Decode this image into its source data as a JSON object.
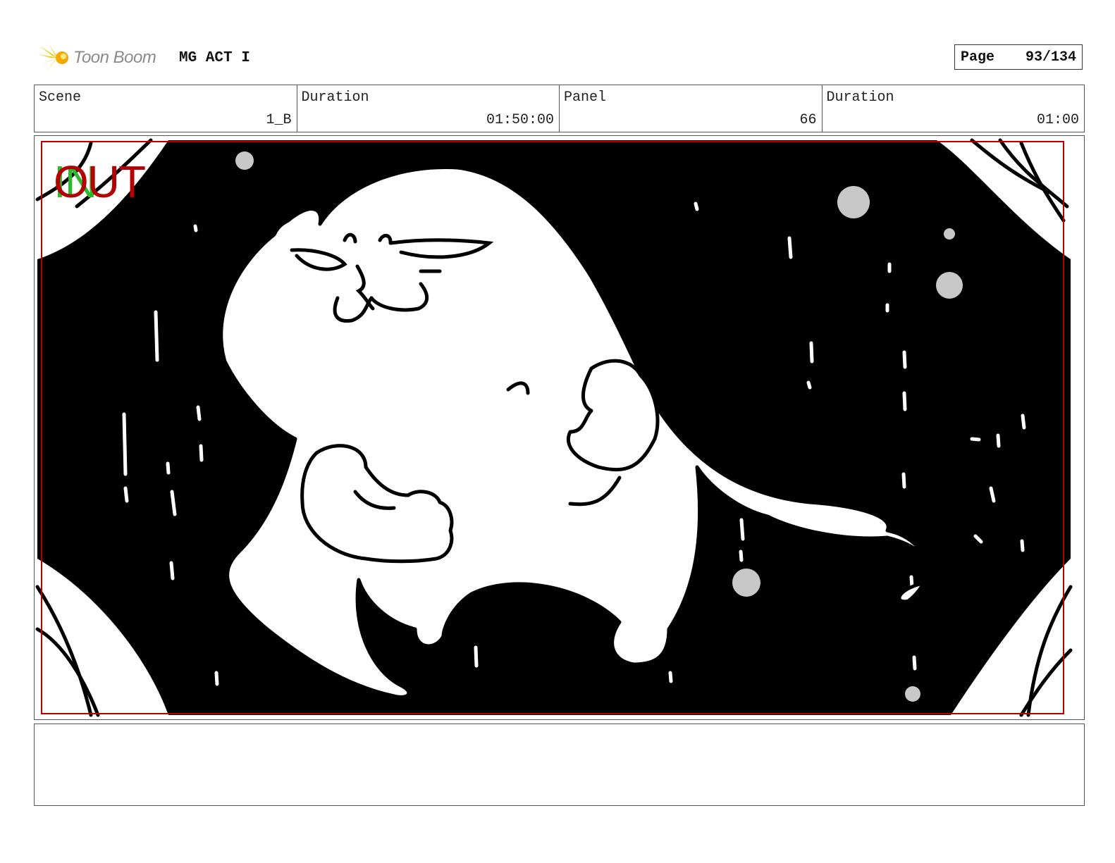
{
  "header": {
    "logo_text": "Toon Boom",
    "project_title": "MG ACT I",
    "page_label": "Page",
    "page_value": "93/134"
  },
  "info": {
    "scene_label": "Scene",
    "scene_value": "1_B",
    "scene_duration_label": "Duration",
    "scene_duration_value": "01:50:00",
    "panel_label": "Panel",
    "panel_value": "66",
    "panel_duration_label": "Duration",
    "panel_duration_value": "01:00"
  },
  "panel": {
    "in_marker": "IN",
    "out_marker": "OUT",
    "colors": {
      "in_marker": "#2eb82e",
      "out_marker": "#b30000",
      "safe_frame": "#b30000",
      "background": "#000000",
      "stars": "#c8c8c8"
    }
  },
  "notes": {
    "text": ""
  }
}
